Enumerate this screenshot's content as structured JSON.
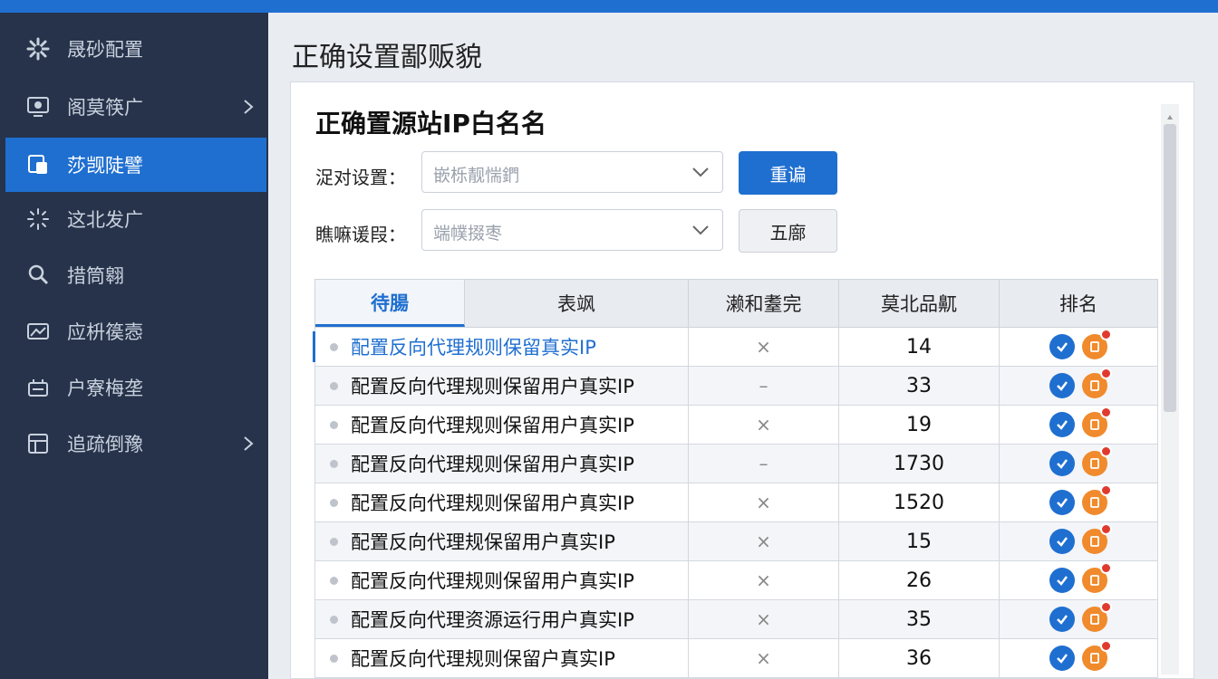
{
  "topbar": {
    "color": "#1f6fd0"
  },
  "sidebar": {
    "items": [
      {
        "icon": "gear-icon",
        "label": "晟砂配置",
        "has_chevron": false,
        "active": false
      },
      {
        "icon": "monitor-icon",
        "label": "阁莫筷广",
        "has_chevron": true,
        "active": false
      },
      {
        "icon": "document-icon",
        "label": "莎觊陡譬",
        "has_chevron": false,
        "active": true
      },
      {
        "icon": "spark-icon",
        "label": "这北发广",
        "has_chevron": false,
        "active": false
      },
      {
        "icon": "search-user-icon",
        "label": "措筒翱",
        "has_chevron": false,
        "active": false
      },
      {
        "icon": "image-icon",
        "label": "应枡篌悫",
        "has_chevron": false,
        "active": false
      },
      {
        "icon": "inbox-icon",
        "label": "户寮梅垄",
        "has_chevron": false,
        "active": false
      },
      {
        "icon": "list-icon",
        "label": "追疏倒豫",
        "has_chevron": true,
        "active": false
      }
    ]
  },
  "main": {
    "title": "正确设置鄙贩貌",
    "section_title": "正确置源站IP白名名",
    "filters": [
      {
        "label": "浞对设置：",
        "placeholder": "嵌栎靓惴鍆"
      },
      {
        "label": "瞧嘛谖叚：",
        "placeholder": "端幞掇枣"
      }
    ],
    "buttons": {
      "primary": "重谝",
      "secondary": "五廍"
    }
  },
  "table": {
    "columns": [
      "待腸",
      "表飒",
      "濑和耋完",
      "莫北品鼿",
      "排名"
    ],
    "rows": [
      {
        "name": "配置反向代理规则保留真实IP",
        "mark": "×",
        "count": "14",
        "selected": true
      },
      {
        "name": "配置反向代理规则保留用户真实IP",
        "mark": "–",
        "count": "33",
        "selected": false
      },
      {
        "name": "配置反向代理规则保留用户真实IP",
        "mark": "×",
        "count": "19",
        "selected": false
      },
      {
        "name": "配置反向代理规则保留用户真实IP",
        "mark": "–",
        "count": "1730",
        "selected": false
      },
      {
        "name": "配置反向代理规则保留用户真实IP",
        "mark": "×",
        "count": "1520",
        "selected": false
      },
      {
        "name": "配置反向代理规保留用户真实IP",
        "mark": "×",
        "count": "15",
        "selected": false
      },
      {
        "name": "配置反向代理规则保留用户真实IP",
        "mark": "×",
        "count": "26",
        "selected": false
      },
      {
        "name": "配置反向代理资源运行用户真实IP",
        "mark": "×",
        "count": "35",
        "selected": false
      },
      {
        "name": "配置反向代理规则保留户真实IP",
        "mark": "×",
        "count": "36",
        "selected": false
      }
    ],
    "action_icons": [
      "check-circle-icon",
      "edit-badge-icon"
    ]
  },
  "colors": {
    "accent": "#1f6fd0",
    "sidebar_bg": "#26334a",
    "orange": "#f08a2c",
    "badge_red": "#e03a2f"
  }
}
